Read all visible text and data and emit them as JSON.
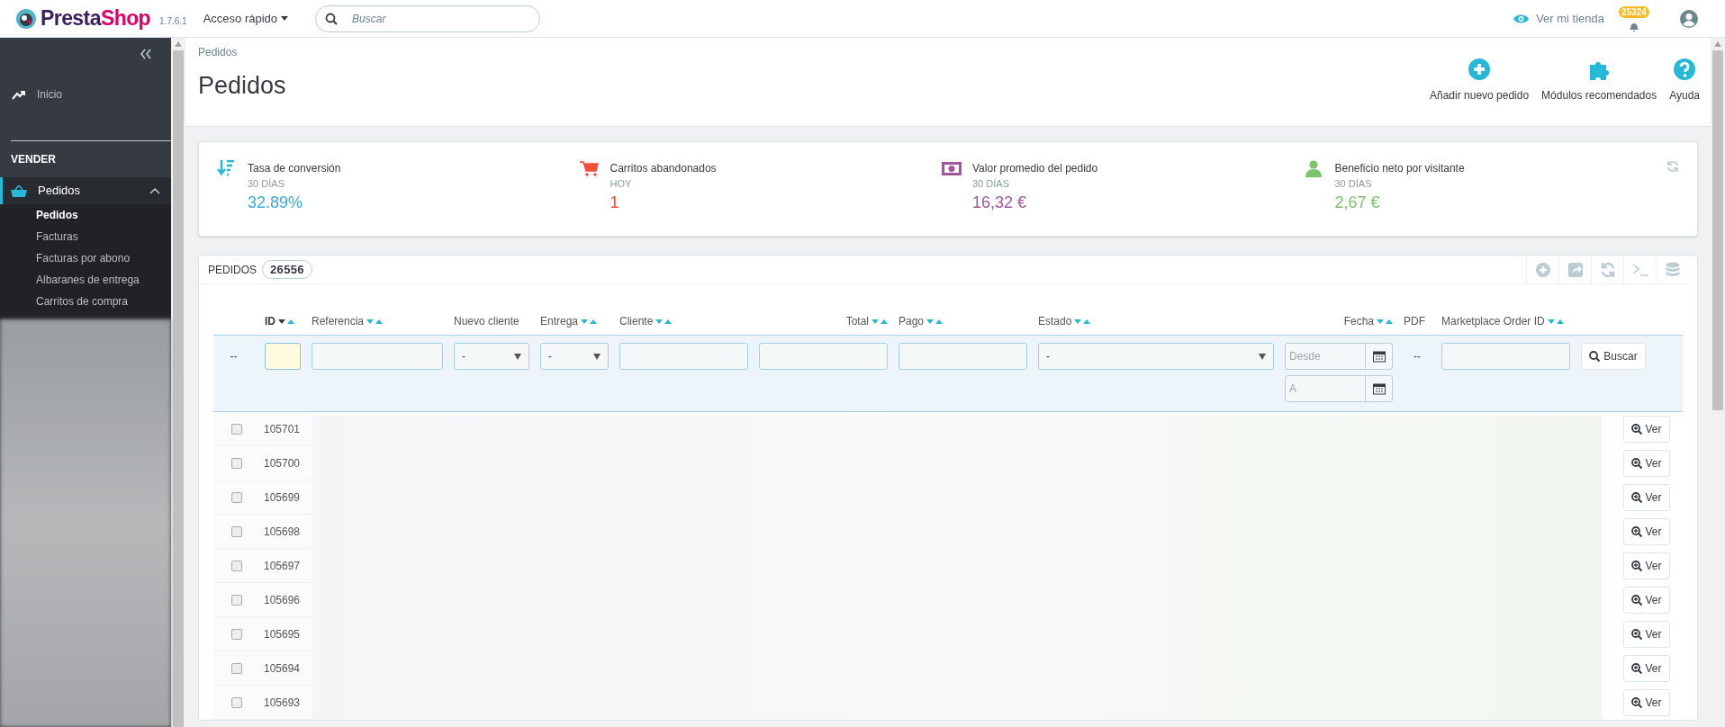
{
  "header": {
    "brand": [
      "Presta",
      "Shop"
    ],
    "version": "1.7.6.1",
    "quick_access": "Acceso rápido",
    "search": {
      "placeholder": "Buscar"
    },
    "view_store": "Ver mi tienda",
    "notifications": "25324"
  },
  "sidebar": {
    "items": [
      {
        "kind": "link",
        "label": "Inicio"
      },
      {
        "kind": "section",
        "label": "VENDER"
      },
      {
        "kind": "group",
        "label": "Pedidos",
        "expanded": true,
        "children": [
          {
            "label": "Pedidos",
            "selected": true
          },
          {
            "label": "Facturas",
            "selected": false
          },
          {
            "label": "Facturas por abono",
            "selected": false
          },
          {
            "label": "Albaranes de entrega",
            "selected": false
          },
          {
            "label": "Carritos de compra",
            "selected": false
          }
        ]
      }
    ]
  },
  "breadcrumb": "Pedidos",
  "page_title": "Pedidos",
  "toolbar": [
    {
      "kind": "add",
      "label": "Añadir nuevo pedido"
    },
    {
      "kind": "modules",
      "label": "Módulos recomendados"
    },
    {
      "kind": "help",
      "label": "Ayuda"
    }
  ],
  "kpis": [
    {
      "kind": "conversion",
      "label": "Tasa de conversión",
      "period": "30 DÍAS",
      "value": "32.89%",
      "color": "#3ea8e0"
    },
    {
      "kind": "cart",
      "label": "Carritos abandonados",
      "period": "HOY",
      "value": "1",
      "color": "#f54c3e"
    },
    {
      "kind": "money",
      "label": "Valor promedio del pedido",
      "period": "30 DÍAS",
      "value": "16,32 €",
      "color": "#a0579b"
    },
    {
      "kind": "user",
      "label": "Beneficio neto por visitante",
      "period": "30 DÍAS",
      "value": "2,67 €",
      "color": "#7cc46b"
    }
  ],
  "table": {
    "title": "PEDIDOS",
    "count": "26556",
    "columns": [
      {
        "label": "ID",
        "sortable": true,
        "sorted_desc": true
      },
      {
        "label": "Referencia",
        "sortable": true,
        "sorted_desc": false
      },
      {
        "label": "Nuevo cliente",
        "sortable": false,
        "sorted_desc": false
      },
      {
        "label": "Entrega",
        "sortable": true,
        "sorted_desc": false
      },
      {
        "label": "Cliente",
        "sortable": true,
        "sorted_desc": false
      },
      {
        "label": "Total",
        "sortable": true,
        "sorted_desc": false
      },
      {
        "label": "Pago",
        "sortable": true,
        "sorted_desc": false
      },
      {
        "label": "Estado",
        "sortable": true,
        "sorted_desc": false
      },
      {
        "label": "Fecha",
        "sortable": true,
        "sorted_desc": false
      },
      {
        "label": "PDF",
        "sortable": false,
        "sorted_desc": false
      },
      {
        "label": "Marketplace Order ID",
        "sortable": true,
        "sorted_desc": false
      }
    ],
    "filters": [
      {
        "kind": "dash",
        "text": "--"
      },
      {
        "kind": "text",
        "focused": true
      },
      {
        "kind": "text",
        "focused": false
      },
      {
        "kind": "select",
        "value": "-"
      },
      {
        "kind": "select",
        "value": "-"
      },
      {
        "kind": "text",
        "focused": false
      },
      {
        "kind": "text",
        "focused": false
      },
      {
        "kind": "text",
        "focused": false
      },
      {
        "kind": "select",
        "value": "-"
      },
      {
        "kind": "date",
        "fields": [
          {
            "placeholder": "Desde"
          },
          {
            "placeholder": "A"
          }
        ]
      },
      {
        "kind": "dash",
        "text": "--"
      },
      {
        "kind": "text",
        "focused": false
      }
    ],
    "search_button": "Buscar",
    "rows": [
      {
        "id": "105701",
        "checked": false,
        "action": "Ver"
      },
      {
        "id": "105700",
        "checked": false,
        "action": "Ver"
      },
      {
        "id": "105699",
        "checked": false,
        "action": "Ver"
      },
      {
        "id": "105698",
        "checked": false,
        "action": "Ver"
      },
      {
        "id": "105697",
        "checked": false,
        "action": "Ver"
      },
      {
        "id": "105696",
        "checked": false,
        "action": "Ver"
      },
      {
        "id": "105695",
        "checked": false,
        "action": "Ver"
      },
      {
        "id": "105694",
        "checked": false,
        "action": "Ver"
      },
      {
        "id": "105693",
        "checked": false,
        "action": "Ver"
      }
    ]
  }
}
